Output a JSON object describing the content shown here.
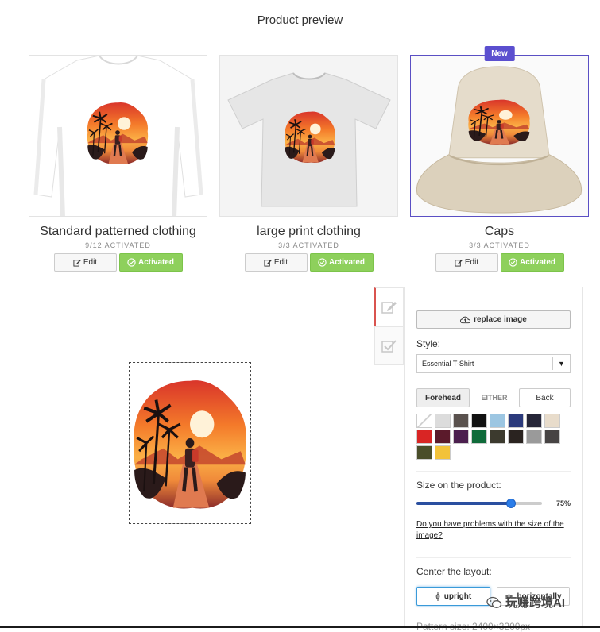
{
  "header": {
    "title": "Product preview"
  },
  "products": [
    {
      "title": "Standard patterned clothing",
      "status": "9/12 ACTIVATED",
      "edit_label": "Edit",
      "activated_label": "Activated",
      "badge": ""
    },
    {
      "title": "large print clothing",
      "status": "3/3 ACTIVATED",
      "edit_label": "Edit",
      "activated_label": "Activated",
      "badge": ""
    },
    {
      "title": "Caps",
      "status": "3/3 ACTIVATED",
      "edit_label": "Edit",
      "activated_label": "Activated",
      "badge": "New"
    }
  ],
  "panel": {
    "replace_label": "replace image",
    "style_label": "Style:",
    "style_value": "Essential T-Shirt",
    "side_front": "Forehead",
    "side_either": "EITHER",
    "side_back": "Back",
    "swatch_colors": [
      "#ffffff",
      "#dcdcdc",
      "#5a524e",
      "#111111",
      "#9cc6e2",
      "#2b3a7c",
      "#262638",
      "#e8dccb",
      "#d92524",
      "#5b1a2b",
      "#4b1f4e",
      "#0f6b3a",
      "#3c3a2e",
      "#2a2320",
      "#9a9a9a",
      "#474444",
      "#4a4e2a",
      "#f2c23a"
    ],
    "size_label": "Size on the product:",
    "size_percent": 75,
    "size_value_text": "75%",
    "help_link": "Do you have problems with the size of the image?",
    "center_label": "Center the layout:",
    "upright_label": "upright",
    "horizontal_label": "horizontally",
    "pattern_size": "Pattern size: 2400×3200px"
  },
  "watermark": {
    "text": "玩赚跨境AI"
  },
  "colors": {
    "accent_purple": "#5b4fcf",
    "activated_green": "#8ed05c",
    "slider_blue": "#2b7de9",
    "active_tab_red": "#d9534f"
  }
}
